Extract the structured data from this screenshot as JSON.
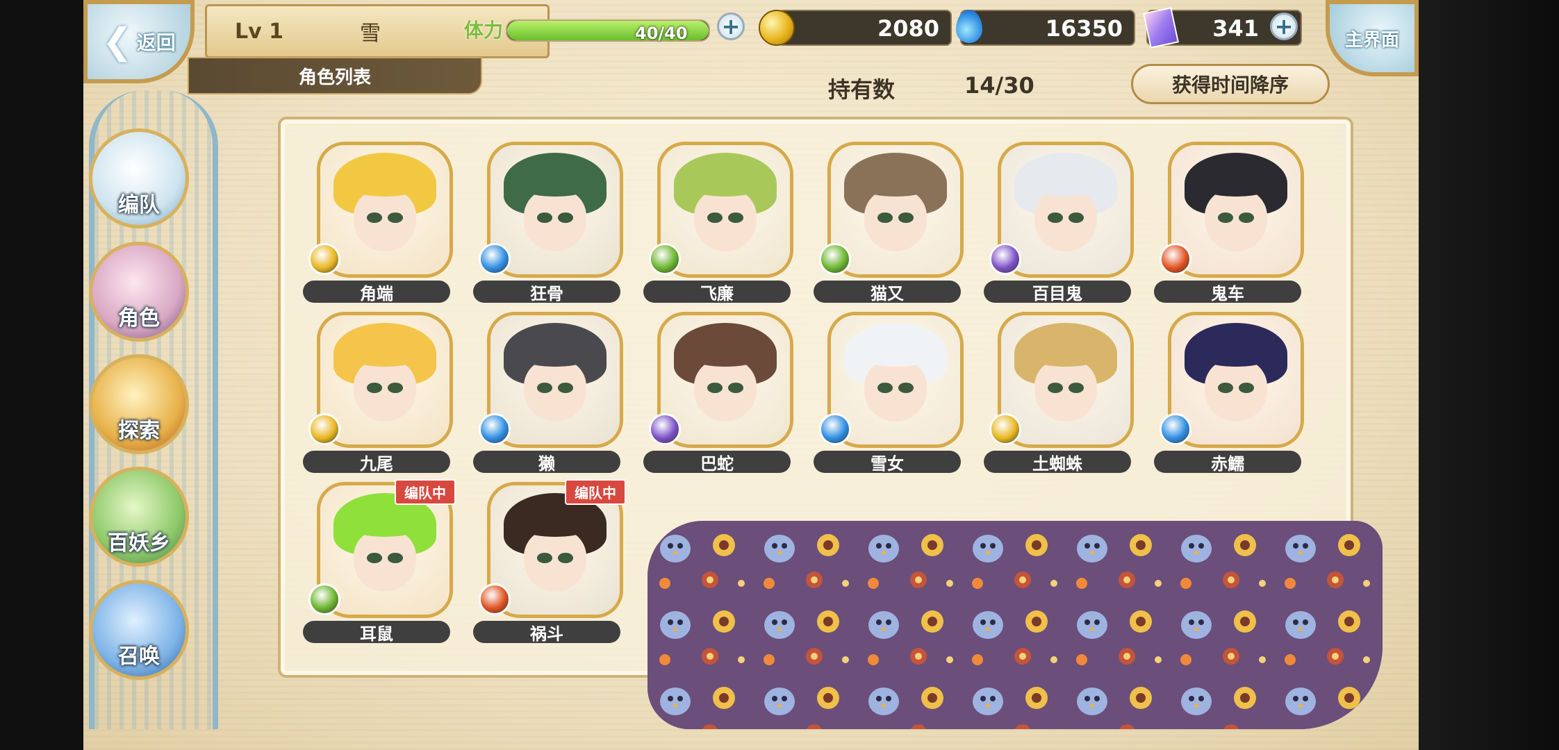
{
  "top": {
    "back_label": "返回",
    "level": "Lv 1",
    "player_name": "雪",
    "list_title": "角色列表",
    "stamina_label": "体力",
    "stamina_value": "40/40",
    "stamina_fraction": 1.0,
    "gold": "2080",
    "blue_currency": "16350",
    "gems": "341",
    "home_label": "主界面"
  },
  "header": {
    "count_label": "持有数",
    "count_value": "14/30",
    "sort_label": "获得时间降序"
  },
  "sidebar": [
    {
      "label": "编队",
      "icon": "team-icon"
    },
    {
      "label": "角色",
      "icon": "character-icon"
    },
    {
      "label": "探索",
      "icon": "explore-icon"
    },
    {
      "label": "百妖乡",
      "icon": "village-icon"
    },
    {
      "label": "召唤",
      "icon": "summon-icon"
    }
  ],
  "characters": [
    {
      "name": "角端",
      "element": "light",
      "hair": "#f2c842",
      "in_team": false
    },
    {
      "name": "狂骨",
      "element": "water",
      "hair": "#3f6b48",
      "in_team": false
    },
    {
      "name": "飞廉",
      "element": "wind",
      "hair": "#a9c85a",
      "in_team": false
    },
    {
      "name": "猫又",
      "element": "wind",
      "hair": "#8a7258",
      "in_team": false
    },
    {
      "name": "百目鬼",
      "element": "dark",
      "hair": "#e6e9ee",
      "in_team": false
    },
    {
      "name": "鬼车",
      "element": "fire",
      "hair": "#2a2a30",
      "in_team": false
    },
    {
      "name": "九尾",
      "element": "light",
      "hair": "#f5c44a",
      "in_team": false
    },
    {
      "name": "獭",
      "element": "water",
      "hair": "#4a4a4e",
      "in_team": false
    },
    {
      "name": "巴蛇",
      "element": "dark",
      "hair": "#6b4a3a",
      "in_team": false
    },
    {
      "name": "雪女",
      "element": "water",
      "hair": "#f0f3f6",
      "in_team": false
    },
    {
      "name": "土蜘蛛",
      "element": "light",
      "hair": "#d8b56a",
      "in_team": false
    },
    {
      "name": "赤鱬",
      "element": "water",
      "hair": "#2c2a5a",
      "in_team": false
    },
    {
      "name": "耳鼠",
      "element": "wind",
      "hair": "#8fe03a",
      "in_team": true
    },
    {
      "name": "祸斗",
      "element": "fire",
      "hair": "#3a2a22",
      "in_team": true
    }
  ],
  "team_badge_label": "编队中",
  "element_colors": {
    "light": "#e8b51f",
    "water": "#2d8de2",
    "wind": "#6ab42c",
    "dark": "#7b4fc6",
    "fire": "#e0501f"
  }
}
